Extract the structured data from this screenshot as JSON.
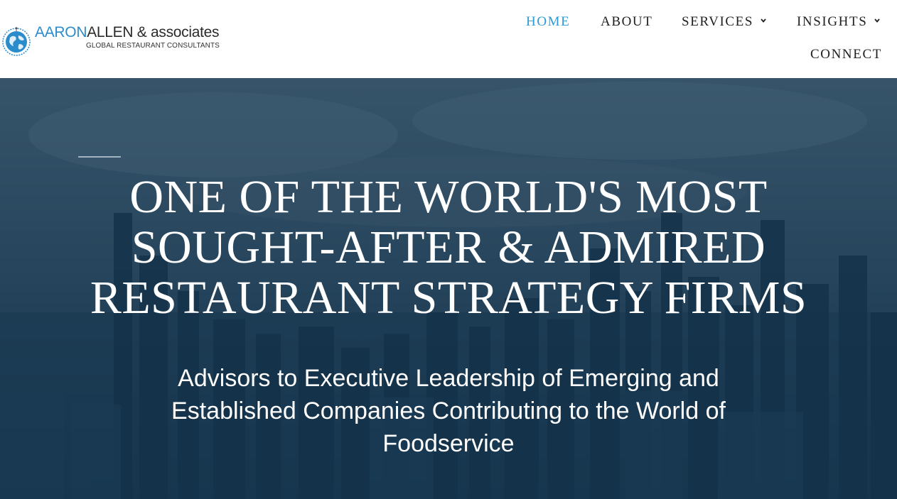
{
  "logo": {
    "name_part1": "AARON",
    "name_part2": "ALLEN & associates",
    "tagline": "GLOBAL RESTAURANT CONSULTANTS"
  },
  "nav": {
    "home": "HOME",
    "about": "ABOUT",
    "services": "SERVICES",
    "insights": "INSIGHTS",
    "connect": "CONNECT"
  },
  "hero": {
    "headline": "ONE OF THE WORLD'S MOST SOUGHT-AFTER & ADMIRED RESTAURANT STRATEGY FIRMS",
    "subhead": "Advisors to Executive Leadership of Emerging and Established Companies Contributing to the World of Foodservice"
  },
  "colors": {
    "accent": "#2b9bd6",
    "hero_overlay": "#1f3d54",
    "nav_text": "#1f1f1f"
  },
  "icons": [
    "globe-logo-icon",
    "chevron-down-icon"
  ]
}
